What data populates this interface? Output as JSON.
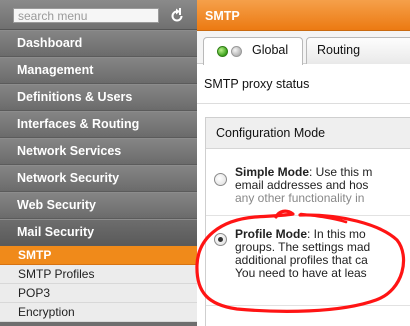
{
  "search": {
    "placeholder": "search menu"
  },
  "sidebar": {
    "items": [
      {
        "label": "Dashboard"
      },
      {
        "label": "Management"
      },
      {
        "label": "Definitions & Users"
      },
      {
        "label": "Interfaces & Routing"
      },
      {
        "label": "Network Services"
      },
      {
        "label": "Network Security"
      },
      {
        "label": "Web Security"
      },
      {
        "label": "Mail Security"
      }
    ],
    "subitems": [
      {
        "label": "SMTP"
      },
      {
        "label": "SMTP Profiles"
      },
      {
        "label": "POP3"
      },
      {
        "label": "Encryption"
      }
    ]
  },
  "main": {
    "title": "SMTP",
    "tabs": [
      {
        "label": "Global"
      },
      {
        "label": "Routing"
      }
    ],
    "status_label": "SMTP proxy status",
    "config": {
      "header": "Configuration Mode",
      "simple": {
        "title": "Simple Mode",
        "lines": [
          ": Use this m",
          "email addresses and hos",
          "any other functionality in"
        ]
      },
      "profile": {
        "title": "Profile Mode",
        "lines": [
          ": In this mo",
          "groups. The settings mad",
          "additional profiles that ca",
          "You need to have at leas"
        ]
      }
    }
  },
  "colors": {
    "accent": "#ec7a12",
    "annotation": "#ff1414"
  }
}
